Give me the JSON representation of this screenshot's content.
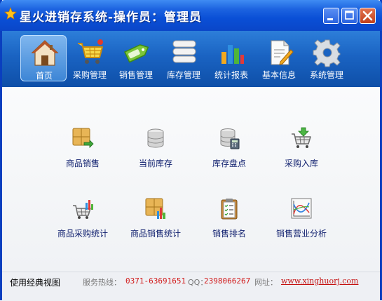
{
  "window": {
    "title": "星火进销存系统-操作员：管理员"
  },
  "toolbar": {
    "items": [
      {
        "label": "首页",
        "icon": "home-icon"
      },
      {
        "label": "采购管理",
        "icon": "shopping-cart-icon"
      },
      {
        "label": "销售管理",
        "icon": "sale-tag-icon"
      },
      {
        "label": "库存管理",
        "icon": "database-stack-icon"
      },
      {
        "label": "统计报表",
        "icon": "bar-chart-icon"
      },
      {
        "label": "基本信息",
        "icon": "edit-document-icon"
      },
      {
        "label": "系统管理",
        "icon": "gear-icon"
      }
    ],
    "active_index": 0
  },
  "dashboard": {
    "items": [
      {
        "label": "商品销售",
        "icon": "product-sales-icon"
      },
      {
        "label": "当前库存",
        "icon": "current-stock-icon"
      },
      {
        "label": "库存盘点",
        "icon": "stock-count-icon"
      },
      {
        "label": "采购入库",
        "icon": "purchase-inbound-icon"
      },
      {
        "label": "商品采购统计",
        "icon": "purchase-stats-icon"
      },
      {
        "label": "商品销售统计",
        "icon": "sales-stats-icon"
      },
      {
        "label": "销售排名",
        "icon": "sales-ranking-icon"
      },
      {
        "label": "销售营业分析",
        "icon": "sales-analysis-icon"
      }
    ]
  },
  "status": {
    "classic_view": "使用经典视图",
    "hotline_label": "服务热线：",
    "hotline_value": "0371-63691651",
    "qq_label": "QQ：",
    "qq_value": "2398066267",
    "site_label": "网址：",
    "site_value": "www.xinghuorj.com"
  },
  "colors": {
    "title_blue": "#0a4fd6",
    "toolbar_blue": "#1a63c2",
    "label_navy": "#0f1f6e",
    "status_red": "#d11b1b"
  }
}
